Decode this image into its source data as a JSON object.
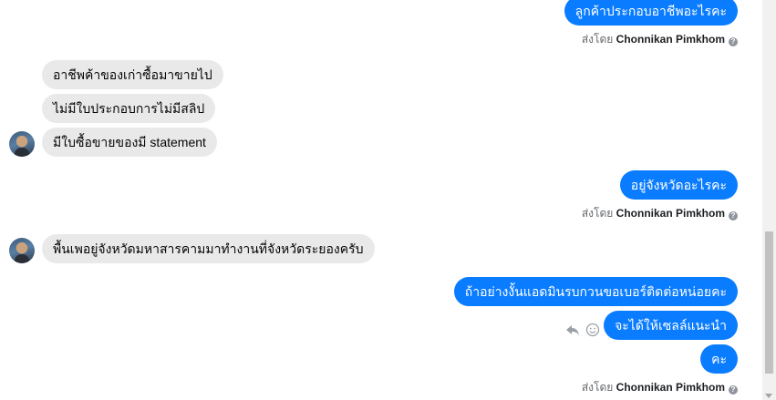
{
  "messages": [
    {
      "text": "ลูกค้าประกอบอาชีพอะไรคะ"
    },
    {
      "text": "อาชีพค้าของเก่าซื้อมาขายไป"
    },
    {
      "text": "ไม่มีใบประกอบการไม่มีสลิป"
    },
    {
      "text": "มีใบซื้อขายของมี statement"
    },
    {
      "text": "อยู่จังหวัดอะไรคะ"
    },
    {
      "text": "พื้นเพอยู่จังหวัดมหาสารคามมาทำงานที่จังหวัดระยองครับ"
    },
    {
      "text": "ถ้าอย่างงั้นแอดมินรบกวนขอเบอร์ติดต่อหน่อยคะ"
    },
    {
      "text": "จะได้ให้เซลล์แนะนำ"
    },
    {
      "text": "คะ"
    }
  ],
  "sent_by": {
    "prefix": "ส่งโดย",
    "name": "Chonnikan Pimkhom",
    "info_glyph": "?"
  },
  "icons": {
    "reply": "reply-icon",
    "react": "smiley-icon",
    "info": "info-icon",
    "avatar": "avatar"
  },
  "colors": {
    "outgoing": "#0a7cff",
    "incoming": "#e9e9e9"
  }
}
